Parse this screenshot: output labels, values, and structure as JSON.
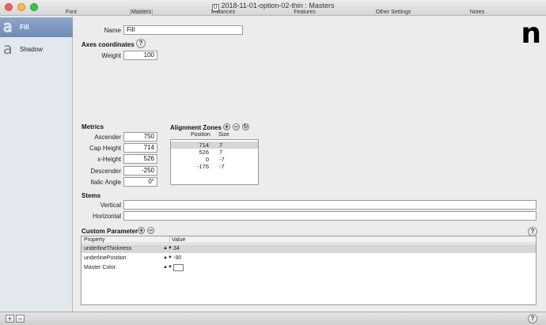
{
  "window": {
    "doc_icon": "U",
    "title": "2018-11-01-option-02-thin : Masters"
  },
  "tabs": [
    {
      "label": "Font"
    },
    {
      "label": "Masters"
    },
    {
      "label": "Instances"
    },
    {
      "label": "Features"
    },
    {
      "label": "Other Settings"
    },
    {
      "label": "Notes"
    }
  ],
  "sidebar": {
    "items": [
      {
        "glyph": "a",
        "label": "Fill"
      },
      {
        "glyph": "a",
        "label": "Shadow"
      }
    ]
  },
  "master": {
    "name_label": "Name",
    "name_value": "Fill",
    "preview_glyph": "n"
  },
  "axes": {
    "title": "Axes coordinates",
    "help": "?",
    "weight_label": "Weight",
    "weight_value": "100"
  },
  "metrics": {
    "title": "Metrics",
    "ascender_label": "Ascender",
    "ascender": "750",
    "cap_height_label": "Cap Height",
    "cap_height": "714",
    "x_height_label": "x-Height",
    "x_height": "526",
    "descender_label": "Descender",
    "descender": "-250",
    "italic_angle_label": "Italic Angle",
    "italic_angle": "0°"
  },
  "alignment_zones": {
    "title": "Alignment Zones",
    "col_position": "Position",
    "col_size": "Size",
    "rows": [
      {
        "position": "714",
        "size": "7"
      },
      {
        "position": "526",
        "size": "7"
      },
      {
        "position": "0",
        "size": "-7"
      },
      {
        "position": "-176",
        "size": "-7"
      }
    ]
  },
  "stems": {
    "title": "Stems",
    "vertical_label": "Vertical",
    "vertical_value": "",
    "horizontal_label": "Horizontal",
    "horizontal_value": ""
  },
  "custom_parameters": {
    "title": "Custom Parameter",
    "help": "?",
    "col_property": "Property",
    "col_value": "Value",
    "rows": [
      {
        "property": "underlineThickness",
        "value": "34"
      },
      {
        "property": "underlinePosition",
        "value": "-90"
      },
      {
        "property": "Master Color",
        "value": ""
      }
    ]
  },
  "bottom": {
    "add": "+",
    "remove": "−",
    "help": "?"
  },
  "colors": {
    "selection": "#7d97bf",
    "sidebar_bg": "#e3e8ef",
    "row_highlight": "#d6d6d6"
  }
}
